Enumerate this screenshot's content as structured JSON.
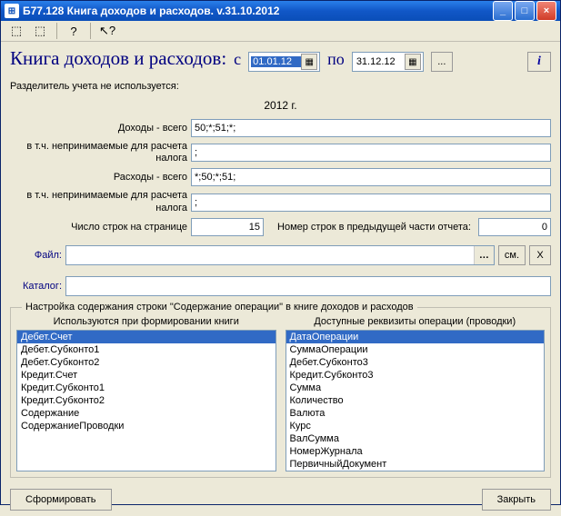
{
  "window": {
    "title": "Б77.128 Книга доходов и расходов. v.31.10.2012"
  },
  "icons": {
    "app": "⊞",
    "tool1": "⬚",
    "tool2": "⬚",
    "help": "?",
    "arrow_help": "↖?",
    "calendar": "▦",
    "info": "i",
    "minimize": "_",
    "maximize": "□",
    "close": "×"
  },
  "heading": "Книга доходов и расходов:",
  "period": {
    "from_label": "с",
    "to_label": "по",
    "from": "01.01.12",
    "to": "31.12.12",
    "more": "..."
  },
  "divider_note": "Разделитель учета не используется:",
  "year_label": "2012 г.",
  "rows": {
    "income_total": {
      "label": "Доходы - всего",
      "value": "50;*;51;*;"
    },
    "income_excl": {
      "label": "в т.ч. непринимаемые для расчета налога",
      "value": ";"
    },
    "expense_total": {
      "label": "Расходы - всего",
      "value": "*;50;*;51;"
    },
    "expense_excl": {
      "label": "в т.ч. непринимаемые для расчета налога",
      "value": ";"
    }
  },
  "lines_per_page": {
    "label": "Число строк на странице",
    "value": "15"
  },
  "prev_line_num": {
    "label": "Номер строк в предыдущей части отчета:",
    "value": "0"
  },
  "file": {
    "label": "Файл:",
    "value": "",
    "view": "см.",
    "clear": "X"
  },
  "catalog": {
    "label": "Каталог:",
    "value": ""
  },
  "config": {
    "legend": "Настройка содержания строки \"Содержание операции\" в книге доходов и расходов",
    "left_header": "Используются при формировании книги",
    "right_header": "Доступные реквизиты операции (проводки)",
    "used": [
      "Дебет.Счет",
      "Дебет.Субконто1",
      "Дебет.Субконто2",
      "Кредит.Счет",
      "Кредит.Субконто1",
      "Кредит.Субконто2",
      "Содержание",
      "СодержаниеПроводки"
    ],
    "available": [
      "ДатаОперации",
      "СуммаОперации",
      "Дебет.Субконто3",
      "Кредит.Субконто3",
      "Сумма",
      "Количество",
      "Валюта",
      "Курс",
      "ВалСумма",
      "НомерЖурнала",
      "ПервичныйДокумент"
    ]
  },
  "buttons": {
    "generate": "Сформировать",
    "close": "Закрыть"
  }
}
